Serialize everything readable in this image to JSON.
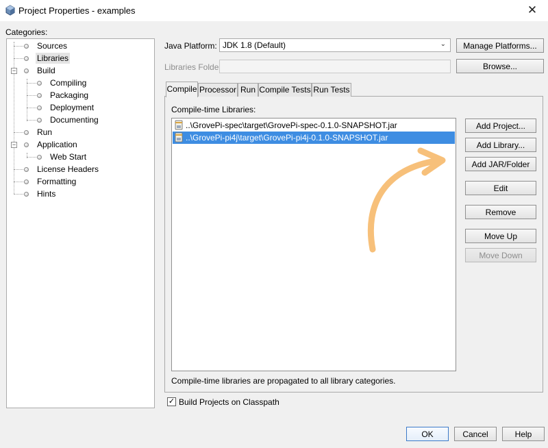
{
  "window": {
    "title": "Project Properties - examples",
    "close_glyph": "✕",
    "icon": "netbeans-cube-icon"
  },
  "categories": {
    "label": "Categories:",
    "items": [
      {
        "label": "Sources",
        "level": 1
      },
      {
        "label": "Libraries",
        "level": 1,
        "selected": true
      },
      {
        "label": "Build",
        "level": 1,
        "expanded": true
      },
      {
        "label": "Compiling",
        "level": 2
      },
      {
        "label": "Packaging",
        "level": 2
      },
      {
        "label": "Deployment",
        "level": 2
      },
      {
        "label": "Documenting",
        "level": 2
      },
      {
        "label": "Run",
        "level": 1
      },
      {
        "label": "Application",
        "level": 1,
        "expanded": true
      },
      {
        "label": "Web Start",
        "level": 2
      },
      {
        "label": "License Headers",
        "level": 1
      },
      {
        "label": "Formatting",
        "level": 1
      },
      {
        "label": "Hints",
        "level": 1
      }
    ]
  },
  "platform": {
    "label": "Java Platform:",
    "value": "JDK 1.8 (Default)",
    "manage_button": "Manage Platforms..."
  },
  "libfolder": {
    "label": "Libraries Folder:",
    "value": "",
    "browse_button": "Browse..."
  },
  "tabs": [
    {
      "label": "Compile",
      "active": true
    },
    {
      "label": "Processor"
    },
    {
      "label": "Run"
    },
    {
      "label": "Compile Tests"
    },
    {
      "label": "Run Tests"
    }
  ],
  "compile": {
    "list_label": "Compile-time Libraries:",
    "entries": [
      {
        "path": "..\\GrovePi-spec\\target\\GrovePi-spec-0.1.0-SNAPSHOT.jar",
        "selected": false
      },
      {
        "path": "..\\GrovePi-pi4j\\target\\GrovePi-pi4j-0.1.0-SNAPSHOT.jar",
        "selected": true
      }
    ],
    "buttons": {
      "add_project": "Add Project...",
      "add_library": "Add Library...",
      "add_jar": "Add JAR/Folder",
      "edit": "Edit",
      "remove": "Remove",
      "move_up": "Move Up",
      "move_down": "Move Down"
    },
    "note": "Compile-time libraries are propagated to all library categories."
  },
  "build_classpath": {
    "label": "Build Projects on Classpath",
    "checked": true,
    "check_glyph": "✓"
  },
  "footer": {
    "ok": "OK",
    "cancel": "Cancel",
    "help": "Help"
  },
  "annotation": {
    "color": "#f7c07a",
    "icon": "curved-arrow-annotation"
  }
}
